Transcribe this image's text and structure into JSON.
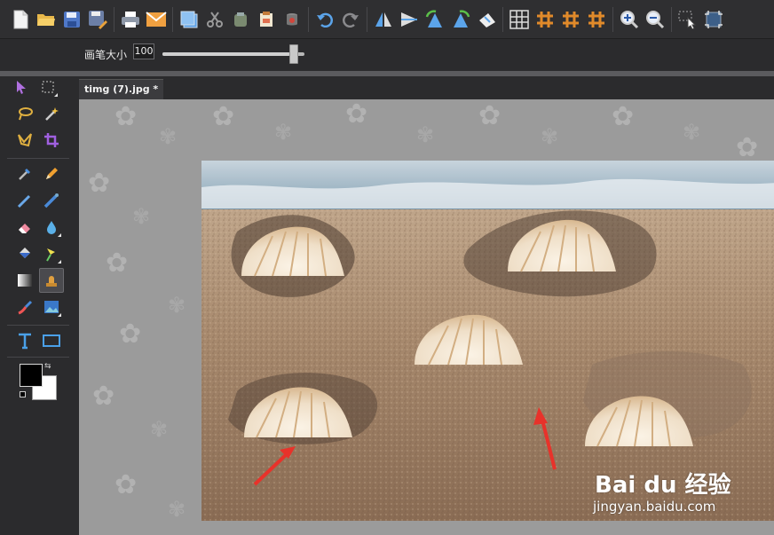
{
  "options": {
    "brush_size_label": "画笔大小",
    "brush_size_value": "100",
    "brush_size_level": 0.95
  },
  "toolbar": {
    "icons": [
      "new-file-icon",
      "open-folder-icon",
      "save-icon",
      "save-as-icon",
      "print-icon",
      "email-icon",
      "duplicate-icon",
      "cut-icon",
      "copy-icon",
      "paste-icon",
      "clear-icon",
      "undo-icon",
      "redo-icon",
      "flip-horizontal-icon",
      "flip-vertical-icon",
      "rotate-left-icon",
      "rotate-right-icon",
      "rotate-free-icon",
      "grid-icon",
      "hash-icon",
      "hash-alt-icon",
      "hash-bold-icon",
      "zoom-in-icon",
      "zoom-out-icon",
      "select-pointer-icon",
      "crop-frame-icon"
    ]
  },
  "tools": {
    "items": [
      "pointer-tool",
      "rect-select-tool",
      "lasso-tool",
      "magic-wand-tool",
      "polygon-lasso-tool",
      "crop-tool",
      "eyedropper-tool",
      "pencil-tool",
      "brush-tool",
      "airbrush-tool",
      "eraser-tool",
      "blur-drop-tool",
      "bucket-tool",
      "color-replace-tool",
      "gradient-tool",
      "clone-stamp-tool",
      "smudge-tool",
      "image-adjust-tool",
      "text-tool",
      "rectangle-shape-tool"
    ],
    "fg_color": "#000000",
    "bg_color": "#ffffff"
  },
  "document": {
    "tab_title": "timg (7).jpg *"
  },
  "watermark": {
    "logo": "Bai du 经验",
    "site": "jingyan.baidu.com"
  },
  "colors": {
    "accent_orange": "#e08a2a",
    "arrow_red": "#e8322a",
    "canvas_gray": "#9b9b9b"
  }
}
